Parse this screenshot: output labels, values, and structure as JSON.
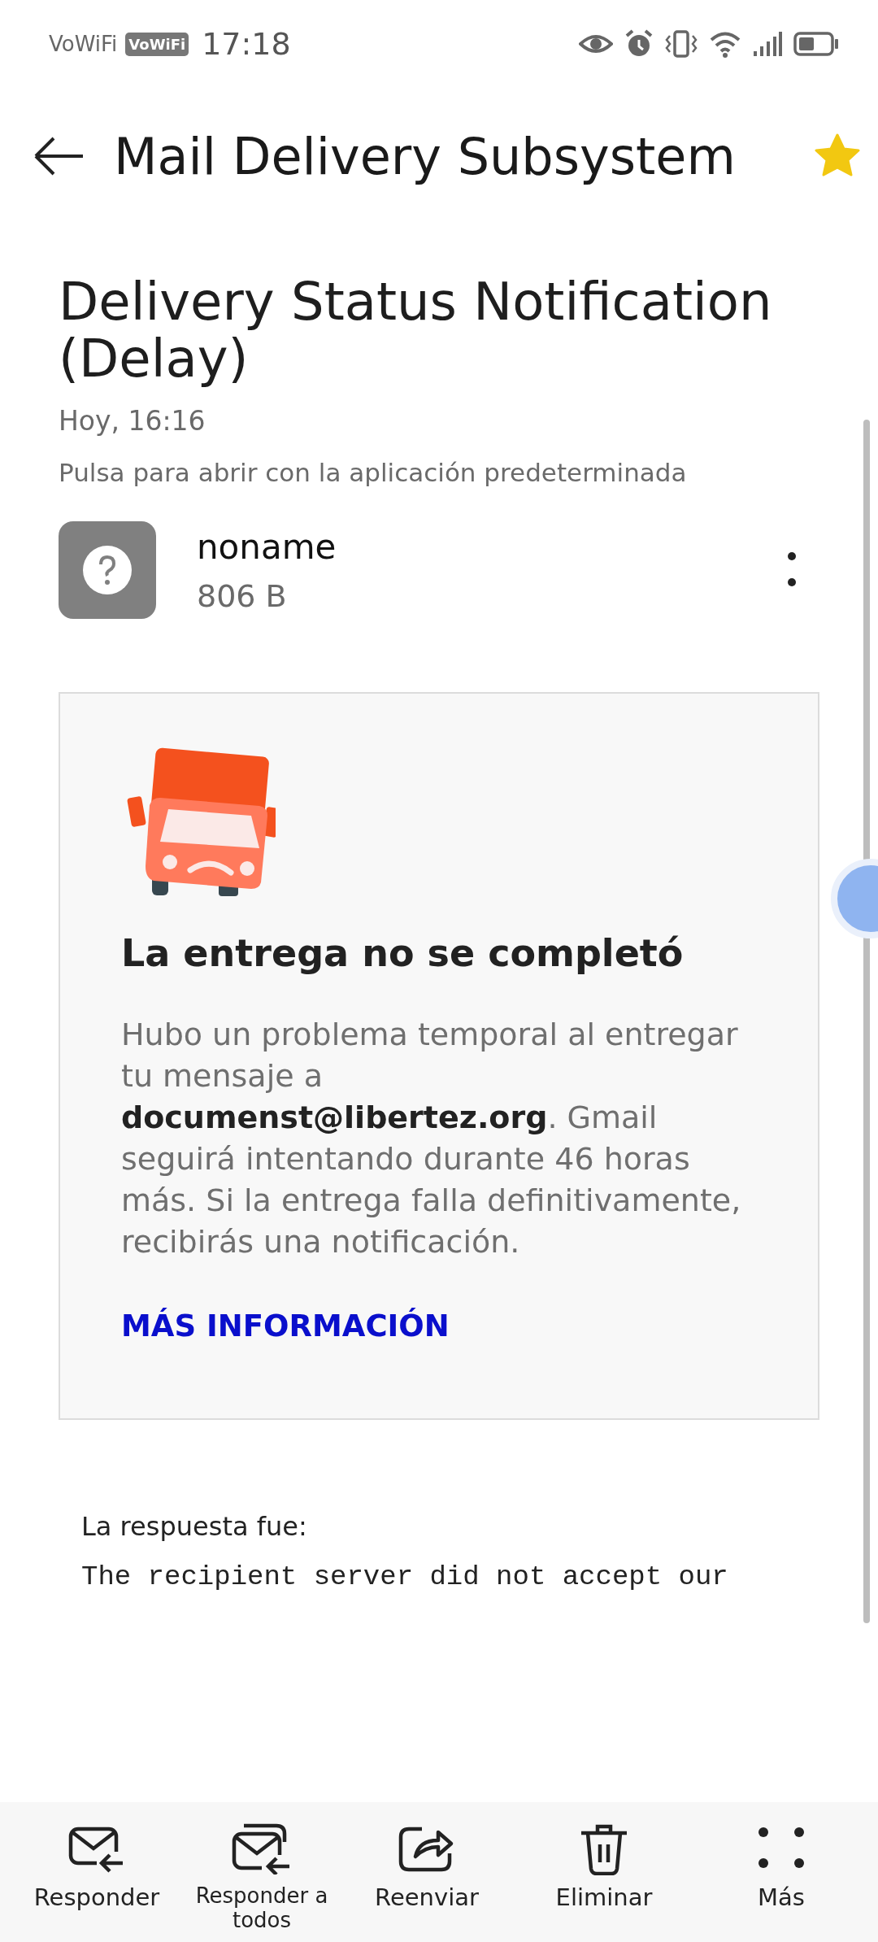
{
  "status_bar": {
    "network_label": "VoWiFi",
    "network_badge": "VoWiFi",
    "time": "17:18"
  },
  "header": {
    "title": "Mail Delivery Subsystem",
    "starred": true
  },
  "message": {
    "subject": "Delivery Status Notification (Delay)",
    "date": "Hoy, 16:16",
    "hint": "Pulsa para abrir con la aplicación predeterminada"
  },
  "attachment": {
    "name": "noname",
    "size": "806 B"
  },
  "notice": {
    "heading": "La entrega no se completó",
    "body": "Hubo un problema temporal al entregar tu mensaje a **documenst@libertez.org**. Gmail seguirá intentando durante 46 horas más. Si la entrega falla definitivamente, recibirás una notificación.",
    "link": "MÁS INFORMACIÓN"
  },
  "reply_label": "La respuesta fue:",
  "reply_text": "The recipient server did not accept our",
  "actions": [
    {
      "kind": "reply",
      "label": "Responder"
    },
    {
      "kind": "reply_all",
      "label": "Responder a todos"
    },
    {
      "kind": "forward",
      "label": "Reenviar"
    },
    {
      "kind": "delete",
      "label": "Eliminar"
    },
    {
      "kind": "more",
      "label": "Más"
    }
  ]
}
